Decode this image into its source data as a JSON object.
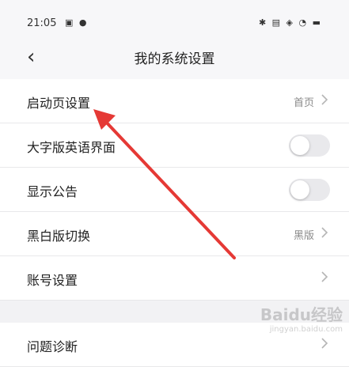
{
  "status_bar": {
    "time": "21:05",
    "left_icons": "▣ ●",
    "right_icons": "✱ ▤ ◈ ◔ ▬"
  },
  "nav": {
    "back_glyph": "‹",
    "title": "我的系统设置"
  },
  "rows": [
    {
      "label": "启动页设置",
      "value": "首页",
      "control": "chevron"
    },
    {
      "label": "大字版英语界面",
      "control": "toggle",
      "on": false
    },
    {
      "label": "显示公告",
      "control": "toggle",
      "on": false
    },
    {
      "label": "黑白版切换",
      "value": "黑版",
      "control": "chevron"
    },
    {
      "label": "账号设置",
      "control": "chevron"
    },
    {
      "label": "问题诊断",
      "control": "chevron"
    }
  ],
  "annotation": {
    "color": "#e53935"
  },
  "watermark": {
    "text": "Baidu经验",
    "sub": "jingyan.baidu.com"
  }
}
